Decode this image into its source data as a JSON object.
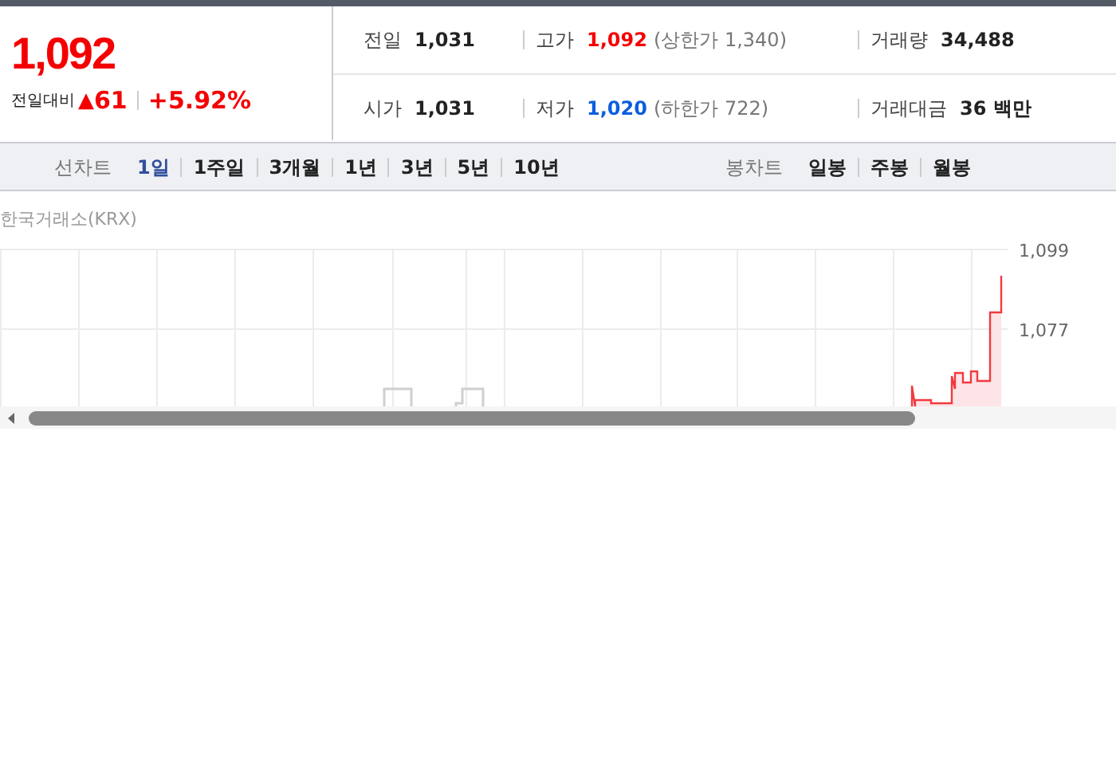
{
  "price": {
    "value": "1,092",
    "change_label": "전일대비",
    "change_icon": "▲",
    "change": "61",
    "percent": "+5.92%"
  },
  "stats": [
    {
      "label": "전일",
      "value": "1,031",
      "color": "#222222"
    },
    {
      "label": "고가",
      "value": "1,092",
      "note": "(상한가 1,340)",
      "color": "#f50000"
    },
    {
      "label": "거래량",
      "value": "34,488",
      "color": "#222222"
    },
    {
      "label": "시가",
      "value": "1,031",
      "color": "#222222"
    },
    {
      "label": "저가",
      "value": "1,020",
      "note": "(하한가 722)",
      "color": "#0a5ede"
    },
    {
      "label": "거래대금",
      "value": "36 백만",
      "color": "#222222"
    }
  ],
  "line_tabs": {
    "label": "선차트",
    "items": [
      {
        "label": "1일",
        "selected": true
      },
      {
        "label": "1주일",
        "selected": false
      },
      {
        "label": "3개월",
        "selected": false
      },
      {
        "label": "1년",
        "selected": false
      },
      {
        "label": "3년",
        "selected": false
      },
      {
        "label": "5년",
        "selected": false
      },
      {
        "label": "10년",
        "selected": false
      }
    ]
  },
  "candle_tabs": {
    "label": "봉차트",
    "items": [
      {
        "label": "일봉",
        "selected": false
      },
      {
        "label": "주봉",
        "selected": false
      },
      {
        "label": "월봉",
        "selected": false
      }
    ]
  },
  "chart": {
    "source": "한국거래소(KRX)",
    "y_labels": [
      "1,099",
      "1,077"
    ]
  }
}
